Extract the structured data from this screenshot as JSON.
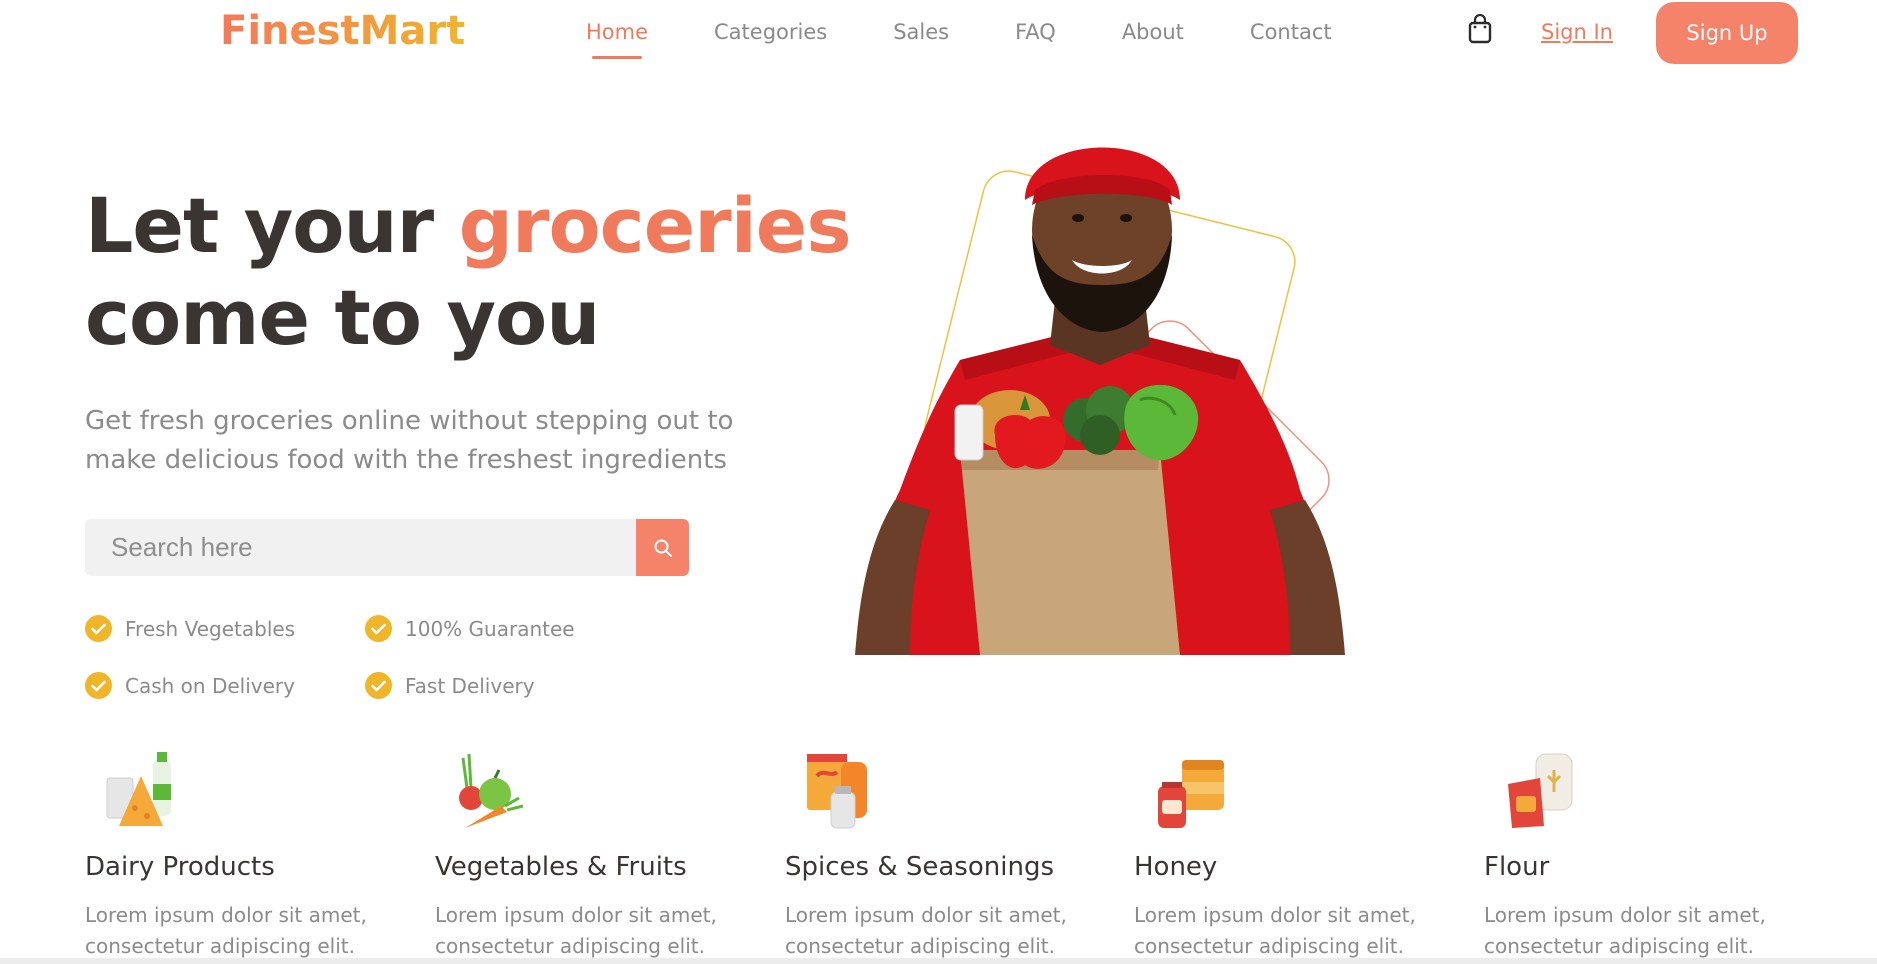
{
  "brand": {
    "name": "FinestMart"
  },
  "nav": {
    "items": [
      {
        "label": "Home",
        "active": true
      },
      {
        "label": "Categories",
        "active": false
      },
      {
        "label": "Sales",
        "active": false
      },
      {
        "label": "FAQ",
        "active": false
      },
      {
        "label": "About",
        "active": false
      },
      {
        "label": "Contact",
        "active": false
      }
    ],
    "cart_icon": "shopping-bag-icon",
    "signin_label": "Sign In",
    "signup_label": "Sign Up"
  },
  "hero": {
    "title_part1": "Let your ",
    "title_accent": "groceries",
    "title_part2": "come to you",
    "subtitle": "Get fresh groceries online without stepping out to make delicious food with the freshest ingredients",
    "search": {
      "placeholder": "Search here",
      "value": "",
      "button_icon": "search-icon"
    },
    "features": [
      {
        "label": "Fresh Vegetables",
        "icon": "check-circle-icon"
      },
      {
        "label": "100% Guarantee",
        "icon": "check-circle-icon"
      },
      {
        "label": "Cash on Delivery",
        "icon": "check-circle-icon"
      },
      {
        "label": "Fast Delivery",
        "icon": "check-circle-icon"
      }
    ],
    "image": "delivery-man-with-grocery-bag"
  },
  "categories": [
    {
      "title": "Dairy Products",
      "description": "Lorem ipsum dolor sit amet, consectetur adipiscing elit.",
      "icon": "dairy-icon"
    },
    {
      "title": "Vegetables & Fruits",
      "description": "Lorem ipsum dolor sit amet, consectetur adipiscing elit.",
      "icon": "vegetables-icon"
    },
    {
      "title": "Spices & Seasonings",
      "description": "Lorem ipsum dolor sit amet, consectetur adipiscing elit.",
      "icon": "spices-icon"
    },
    {
      "title": "Honey",
      "description": "Lorem ipsum dolor sit amet, consectetur adipiscing elit.",
      "icon": "honey-icon"
    },
    {
      "title": "Flour",
      "description": "Lorem ipsum dolor sit amet, consectetur adipiscing elit.",
      "icon": "flour-icon"
    }
  ],
  "colors": {
    "accent": "#f07b5c",
    "button": "#f4836a",
    "check": "#f1b52a",
    "text_dark": "#3a3533",
    "text_muted": "#8b8b8b"
  }
}
